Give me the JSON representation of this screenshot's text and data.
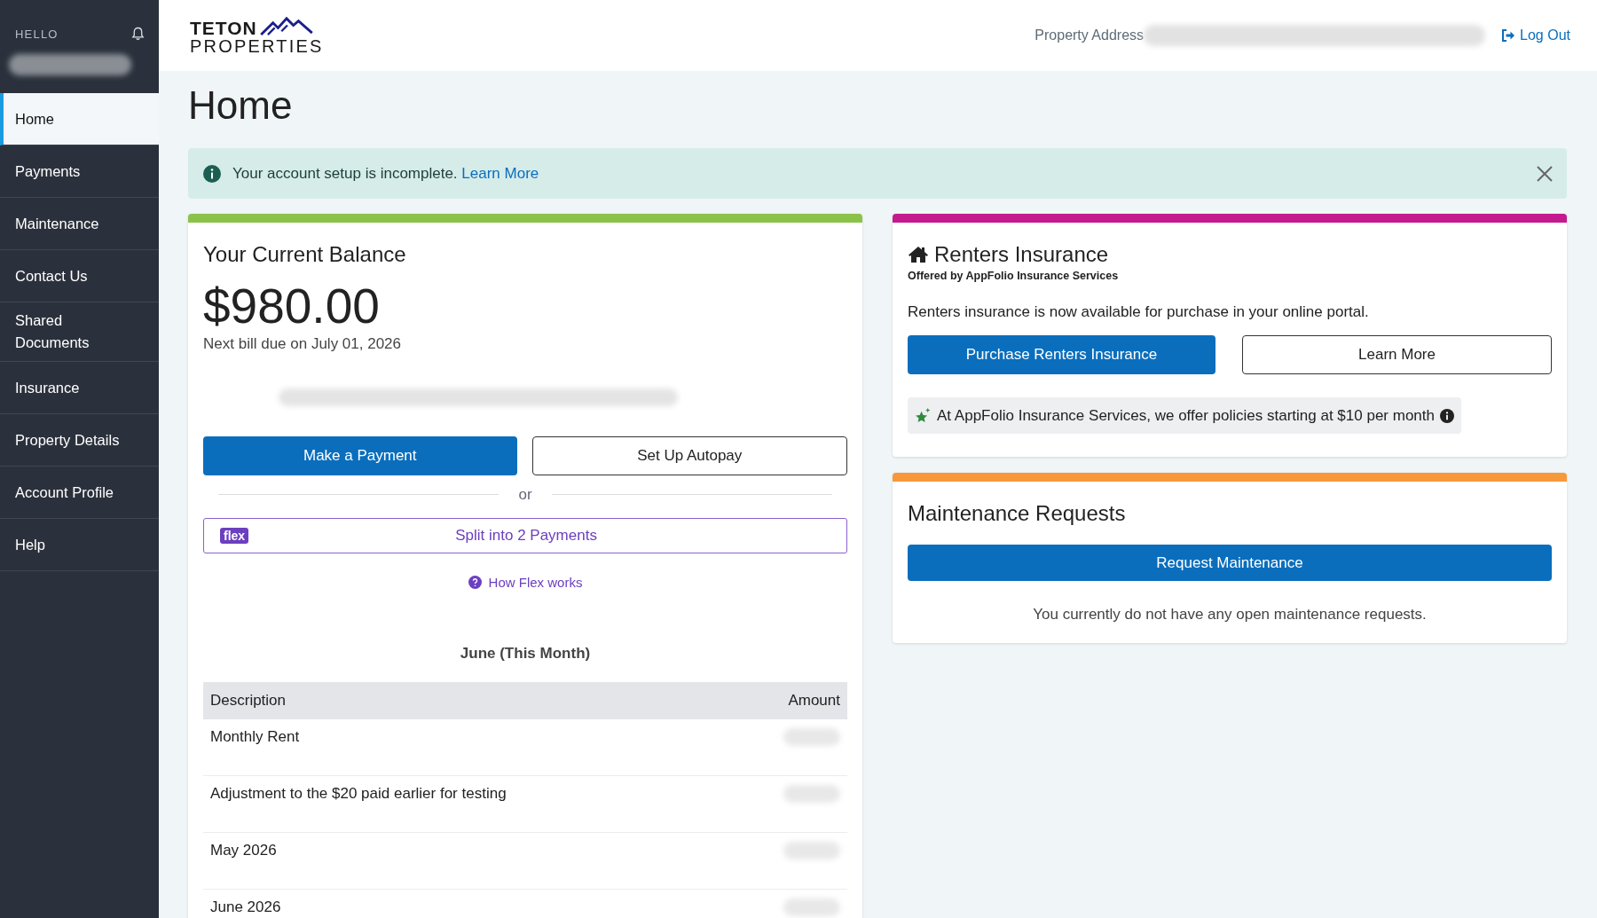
{
  "sidebar": {
    "greeting": "HELLO",
    "nav": [
      {
        "label": "Home",
        "selected": true
      },
      {
        "label": "Payments",
        "selected": false
      },
      {
        "label": "Maintenance",
        "selected": false
      },
      {
        "label": "Contact Us",
        "selected": false
      },
      {
        "label": "Shared Documents",
        "selected": false
      },
      {
        "label": "Insurance",
        "selected": false
      },
      {
        "label": "Property Details",
        "selected": false
      },
      {
        "label": "Account Profile",
        "selected": false
      },
      {
        "label": "Help",
        "selected": false
      }
    ]
  },
  "header": {
    "logo_top": "TETON",
    "logo_bottom": "PROPERTIES",
    "property_label": "Property Address",
    "logout": "Log Out"
  },
  "page_title": "Home",
  "alert": {
    "text": "Your account setup is incomplete.",
    "link": "Learn More"
  },
  "balance_card": {
    "title": "Your Current Balance",
    "amount": "$980.00",
    "due": "Next bill due on July 01, 2026",
    "primary_button": "Make a Payment",
    "secondary_button": "Set Up Autopay",
    "divider": "or",
    "flex_badge": "flex",
    "flex_button": "Split into 2 Payments",
    "flex_help": "How Flex works",
    "period": "June (This Month)",
    "table": {
      "columns": [
        "Description",
        "Amount"
      ],
      "rows": [
        {
          "description": "Monthly Rent"
        },
        {
          "description": "Adjustment to the $20 paid earlier for testing"
        },
        {
          "description": "May 2026"
        },
        {
          "description": "June 2026"
        }
      ]
    }
  },
  "insurance_card": {
    "title": "Renters Insurance",
    "subtitle": "Offered by AppFolio Insurance Services",
    "text": "Renters insurance is now available for purchase in your online portal.",
    "primary_button": "Purchase Renters Insurance",
    "secondary_button": "Learn More",
    "offer": "At AppFolio Insurance Services, we offer policies starting at $10 per month"
  },
  "maintenance_card": {
    "title": "Maintenance Requests",
    "button": "Request Maintenance",
    "empty": "You currently do not have any open maintenance requests."
  }
}
